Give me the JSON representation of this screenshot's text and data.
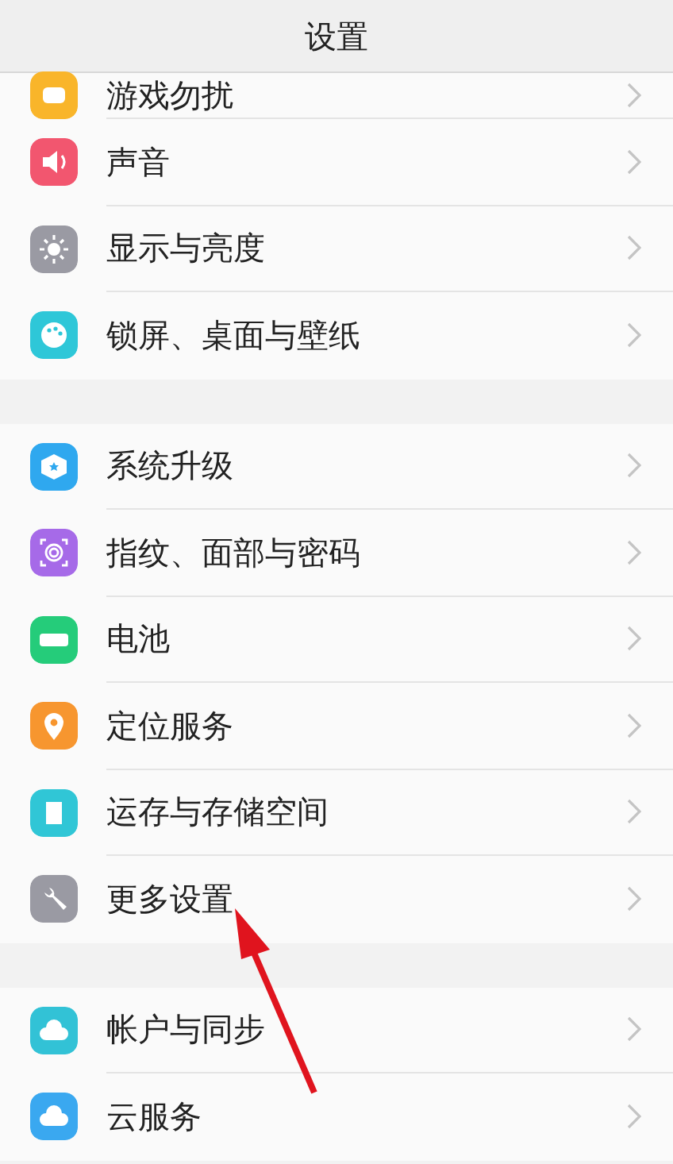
{
  "window": {
    "title": "设置"
  },
  "groups": [
    {
      "items": [
        {
          "label": "游戏勿扰",
          "color": "#f9b52a",
          "kind": "game"
        },
        {
          "label": "声音",
          "color": "#f2566f",
          "kind": "sound"
        },
        {
          "label": "显示与亮度",
          "color": "#9a9aa3",
          "kind": "display"
        },
        {
          "label": "锁屏、桌面与壁纸",
          "color": "#2ec7d8",
          "kind": "palette"
        }
      ]
    },
    {
      "items": [
        {
          "label": "系统升级",
          "color": "#2fa8ef",
          "kind": "update"
        },
        {
          "label": "指纹、面部与密码",
          "color": "#a66ae8",
          "kind": "fingerprint"
        },
        {
          "label": "电池",
          "color": "#25cc7a",
          "kind": "battery"
        },
        {
          "label": "定位服务",
          "color": "#f7962f",
          "kind": "location"
        },
        {
          "label": "运存与存储空间",
          "color": "#30c6d6",
          "kind": "storage"
        },
        {
          "label": "更多设置",
          "color": "#9a9aa3",
          "kind": "wrench"
        }
      ]
    },
    {
      "items": [
        {
          "label": "帐户与同步",
          "color": "#32c2d6",
          "kind": "cloud"
        },
        {
          "label": "云服务",
          "color": "#3aa8f0",
          "kind": "cloud"
        }
      ]
    }
  ]
}
